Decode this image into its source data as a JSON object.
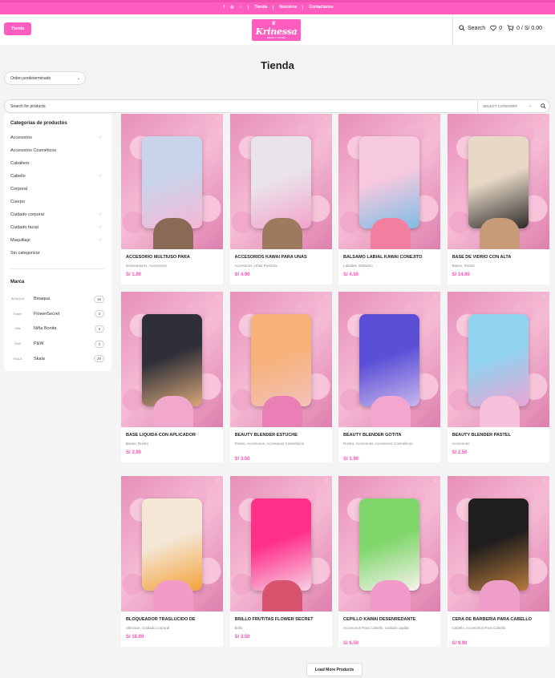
{
  "topbar": {
    "links": [
      "Tienda",
      "Nosotros",
      "Contactanos"
    ]
  },
  "header": {
    "shop_button": "Tienda",
    "logo_text": "Krinessa",
    "logo_tagline": "BEAUTY STORE",
    "search_label": "Search",
    "wishlist_count": "0",
    "cart_label": "0 / S/ 0.00"
  },
  "page": {
    "title": "Tienda"
  },
  "sort": {
    "selected": "Orden predeterminado"
  },
  "search": {
    "placeholder": "Search for products",
    "category": "SELECT CATEGORY"
  },
  "sidebar": {
    "categories_title": "Categorías de productos",
    "categories": [
      {
        "label": "Accesorios",
        "expandable": true
      },
      {
        "label": "Accesorios Cosméticos",
        "expandable": false
      },
      {
        "label": "Caballero",
        "expandable": false
      },
      {
        "label": "Cabello",
        "expandable": true
      },
      {
        "label": "Corporal",
        "expandable": false
      },
      {
        "label": "Cuerpo",
        "expandable": false
      },
      {
        "label": "Cuidado corporal",
        "expandable": true
      },
      {
        "label": "Cuidado facial",
        "expandable": true
      },
      {
        "label": "Maquillaje",
        "expandable": true
      },
      {
        "label": "Sin categorizar",
        "expandable": false
      }
    ],
    "brands_title": "Marca",
    "brands": [
      {
        "name": "Bioaqua",
        "count": "18",
        "logo": "BIOAQUA"
      },
      {
        "name": "FlowerSecret",
        "count": "3",
        "logo": "Flower"
      },
      {
        "name": "Niña Bonita",
        "count": "5",
        "logo": "Niña"
      },
      {
        "name": "P&W",
        "count": "2",
        "logo": "P&W"
      },
      {
        "name": "Skala",
        "count": "29",
        "logo": "SKALA"
      }
    ]
  },
  "products": [
    {
      "name": "ACCESORIO MULTIUSO PARA",
      "cats": "Delineadores, Accesorios",
      "price": "S/ 1.90",
      "colors": [
        "#c9d3ea",
        "#f7b7d6",
        "#8a6a55"
      ]
    },
    {
      "name": "ACCESORIOS KAWAI PARA UÑAS",
      "cats": "Accesorios, Uñas Postizas",
      "price": "S/ 4.90",
      "colors": [
        "#e9e4ea",
        "#f3a3cc",
        "#9c7a5f"
      ]
    },
    {
      "name": "BALSAMO LABIAL KAWAI CONEJITO",
      "cats": "Labiales, Bálsamo",
      "price": "S/ 4.50",
      "colors": [
        "#f6c9de",
        "#7dbde6",
        "#f27fa0"
      ]
    },
    {
      "name": "BASE DE VIDRIO CON ALTA",
      "cats": "Bases, Rostro",
      "price": "S/ 14.90",
      "colors": [
        "#e8d9c7",
        "#2d2a2a",
        "#c79b7a"
      ]
    },
    {
      "name": "BASE LIQUIDA CON APLICADOR",
      "cats": "Bases, Rostro",
      "price": "S/ 3.90",
      "colors": [
        "#2e2f38",
        "#d8a77a",
        "#f2a8cc"
      ]
    },
    {
      "name": "BEAUTY BLENDER ESTUCHE",
      "cats": "Rostro, Accesorios, Accesorios Cosméticos",
      "price": "S/ 3.50",
      "colors": [
        "#f7b27a",
        "#f3c1b8",
        "#e97fb5"
      ]
    },
    {
      "name": "BEAUTY BLENDER GOTITA",
      "cats": "Rostro, Accesorios, Accesorios Cosméticos",
      "price": "S/ 1.90",
      "colors": [
        "#5a4fd6",
        "#c8b7ee",
        "#f3a6cf"
      ]
    },
    {
      "name": "BEAUTY BLENDER PASTEL",
      "cats": "Accesorios",
      "price": "S/ 2.50",
      "colors": [
        "#8fd3f0",
        "#e9a6d4",
        "#f6c0da"
      ]
    },
    {
      "name": "BLOQUEADOR TRASLÚCIDO DE",
      "cats": "Skincare, Cuidado corporal",
      "price": "S/ 16.90",
      "colors": [
        "#f4e7d6",
        "#f3a23b",
        "#f19bc6"
      ]
    },
    {
      "name": "BRILLO FRUTITAS FLOWER SECRET",
      "cats": "Brillo",
      "price": "S/ 3.50",
      "colors": [
        "#ff2f8a",
        "#f7d1e4",
        "#d8546e"
      ]
    },
    {
      "name": "CEPILLO KAWAI DESENREDANTE",
      "cats": "Accesorios Para Cabello, cuidado capilar",
      "price": "S/ 6.50",
      "colors": [
        "#7fd66a",
        "#f7f3ee",
        "#f29ac9"
      ]
    },
    {
      "name": "CERA DE BARBERIA PARA CABELLO",
      "cats": "Cabello, Accesorios Para Cabello",
      "price": "S/ 9.90",
      "colors": [
        "#1f1d1d",
        "#b87a3c",
        "#ee9ec8"
      ]
    }
  ],
  "load_more": "Load More Products"
}
